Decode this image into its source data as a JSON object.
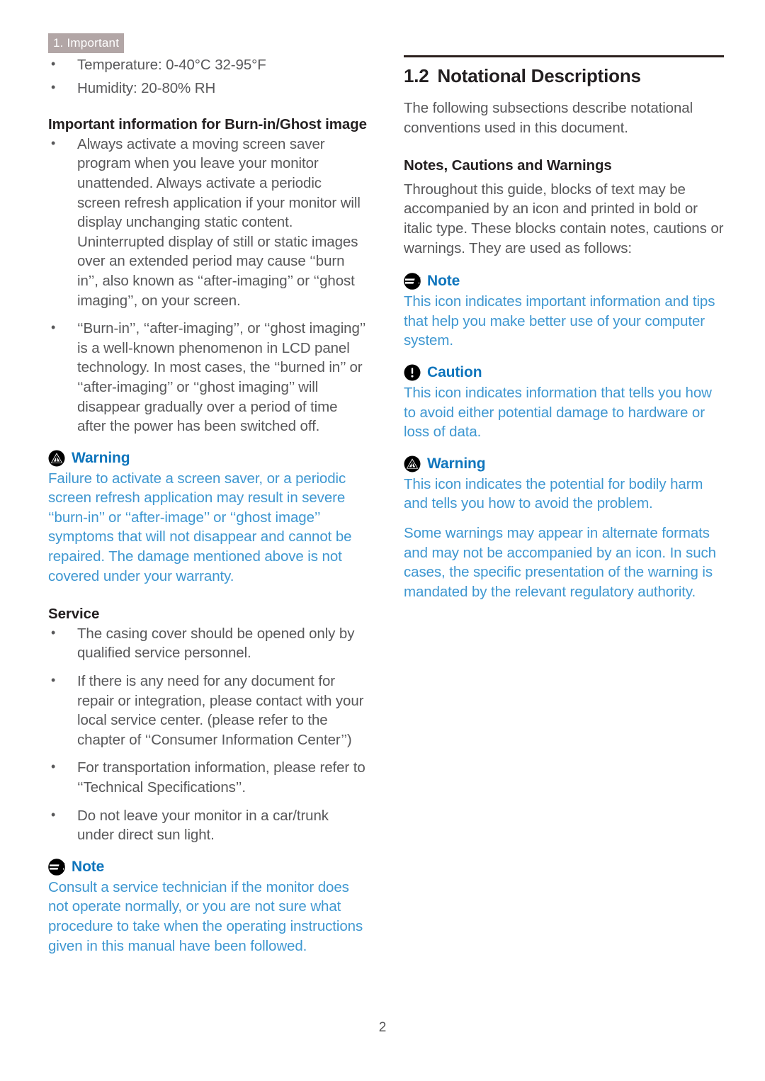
{
  "header": {
    "chapter_tab": "1. Important"
  },
  "left_column": {
    "env_bullets": [
      "Temperature: 0-40°C 32-95°F",
      "Humidity: 20-80% RH"
    ],
    "burnin_heading": "Important information for Burn-in/Ghost image",
    "burnin_bullets": [
      "Always activate a moving screen saver program when you leave your monitor unattended. Always activate a periodic screen refresh application if your monitor will display unchanging static content. Uninterrupted display of still or static images over an extended period may cause ‘‘burn in’’, also known as ‘‘after-imaging’’ or ‘‘ghost imaging’’, on your screen.",
      "‘‘Burn-in’’, ‘‘after-imaging’’, or ‘‘ghost imaging’’ is a well-known phenomenon in LCD panel technology. In most cases, the ‘‘burned in’’ or ‘‘after-imaging’’ or ‘‘ghost imaging’’ will disappear gradually over a period of time after the power has been switched off."
    ],
    "warning": {
      "icon": "warning-triangle-icon",
      "title": "Warning",
      "body": "Failure to activate a screen saver, or a periodic screen refresh application may result in severe ‘‘burn-in’’ or ‘‘after-image’’ or ‘‘ghost image’’ symptoms that will not disappear and cannot be repaired. The damage mentioned above is not covered under your warranty."
    },
    "service_heading": "Service",
    "service_bullets": [
      "The casing cover should be opened only by qualified service personnel.",
      "If there is any need for any document for repair or integration, please contact with your local service center. (please refer to the chapter of ‘‘Consumer Information Center’’)",
      "For transportation information, please refer to ‘‘Technical Specifications’’.",
      "Do not leave your monitor in a car/trunk under direct sun light."
    ],
    "note": {
      "icon": "note-lines-icon",
      "title": "Note",
      "body": "Consult a service technician if the monitor does not operate normally, or you are not sure what procedure to take when the operating instructions given in this manual have been followed."
    }
  },
  "right_column": {
    "section_number": "1.2",
    "section_title": "Notational Descriptions",
    "intro": "The following subsections describe notational conventions used in this document.",
    "subheading": "Notes, Cautions and Warnings",
    "subintro": "Throughout this guide, blocks of text may be accompanied by an icon and printed in bold or italic type. These blocks contain notes, cautions or warnings. They are used as follows:",
    "note": {
      "icon": "note-lines-icon",
      "title": "Note",
      "body": "This icon indicates important information and tips that help you make better use of your computer system."
    },
    "caution": {
      "icon": "caution-exclamation-icon",
      "title": "Caution",
      "body": "This icon indicates information that tells you how to avoid either potential damage to hardware or loss of data."
    },
    "warning": {
      "icon": "warning-triangle-icon",
      "title": "Warning",
      "body": "This icon indicates the potential for bodily harm and tells you how to avoid the problem.",
      "body2": "Some warnings may appear in alternate formats and may not be accompanied by an icon. In such cases, the specific presentation of the warning is mandated by the relevant regulatory authority."
    }
  },
  "footer": {
    "page_number": "2"
  },
  "colors": {
    "tab_background": "#b2a6a6",
    "tab_text": "#ffffff",
    "body_text": "#58585a",
    "heading_text": "#231f20",
    "callout_title": "#0f75bc",
    "callout_body": "#3e97d1",
    "rule": "#2b201d"
  }
}
